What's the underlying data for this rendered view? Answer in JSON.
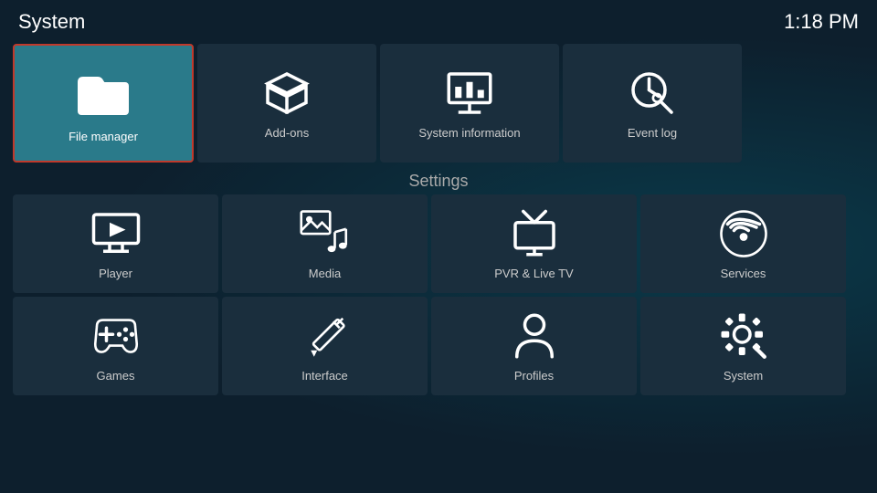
{
  "header": {
    "title": "System",
    "time": "1:18 PM"
  },
  "top_tiles": [
    {
      "id": "file-manager",
      "label": "File manager",
      "icon": "folder"
    },
    {
      "id": "add-ons",
      "label": "Add-ons",
      "icon": "box"
    },
    {
      "id": "system-information",
      "label": "System information",
      "icon": "presentation"
    },
    {
      "id": "event-log",
      "label": "Event log",
      "icon": "clock-search"
    }
  ],
  "settings_label": "Settings",
  "settings_tiles_row1": [
    {
      "id": "player",
      "label": "Player",
      "icon": "play-screen"
    },
    {
      "id": "media",
      "label": "Media",
      "icon": "media-notes"
    },
    {
      "id": "pvr-live-tv",
      "label": "PVR & Live TV",
      "icon": "tv-antenna"
    },
    {
      "id": "services",
      "label": "Services",
      "icon": "wifi-circle"
    }
  ],
  "settings_tiles_row2": [
    {
      "id": "games",
      "label": "Games",
      "icon": "gamepad"
    },
    {
      "id": "interface",
      "label": "Interface",
      "icon": "pencil-ruler"
    },
    {
      "id": "profiles",
      "label": "Profiles",
      "icon": "person"
    },
    {
      "id": "system",
      "label": "System",
      "icon": "gear-wrench"
    }
  ]
}
